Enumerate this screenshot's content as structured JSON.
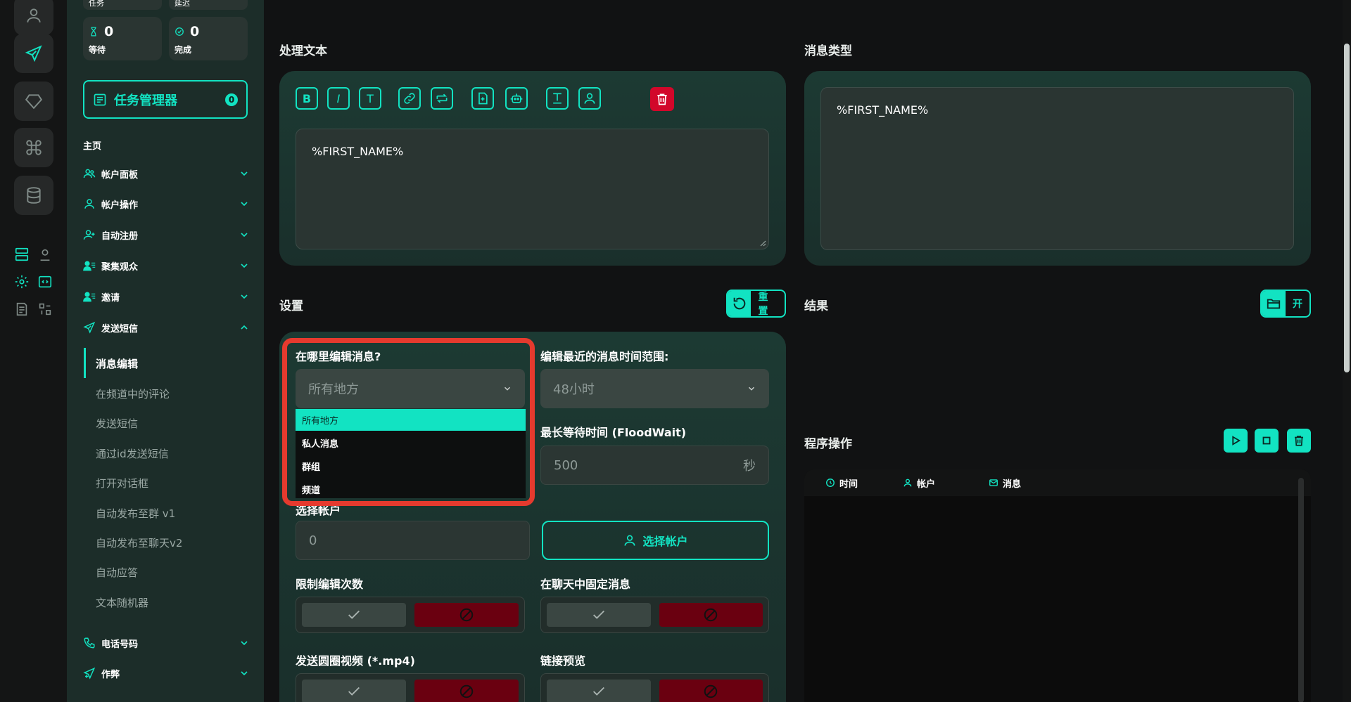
{
  "sidebar": {
    "stats_top": [
      "任务",
      "延迟"
    ],
    "stats": [
      {
        "value": "0",
        "label": "等待"
      },
      {
        "value": "0",
        "label": "完成"
      }
    ],
    "task_manager": {
      "label": "任务管理器",
      "count": "0"
    },
    "section_title": "主页",
    "nav": [
      {
        "label": "帐户面板",
        "icon": "users-icon"
      },
      {
        "label": "帐户操作",
        "icon": "user-icon"
      },
      {
        "label": "自动注册",
        "icon": "user-plus-icon"
      },
      {
        "label": "聚集观众",
        "icon": "user-list-icon"
      },
      {
        "label": "邀请",
        "icon": "user-list-icon"
      },
      {
        "label": "发送短信",
        "icon": "send-icon"
      }
    ],
    "sub_items": [
      "消息编辑",
      "在频道中的评论",
      "发送短信",
      "通过id发送短信",
      "打开对话框",
      "自动发布至群 v1",
      "自动发布至聊天v2",
      "自动应答",
      "文本随机器"
    ],
    "nav_bottom": [
      {
        "label": "电话号码",
        "icon": "phone-icon"
      },
      {
        "label": "作弊",
        "icon": "send-plus-icon"
      }
    ]
  },
  "editor": {
    "label": "处理文本",
    "toolbar": [
      "B",
      "I",
      "T"
    ],
    "text": "%FIRST_NAME%"
  },
  "message_type": {
    "label": "消息类型",
    "text": "%FIRST_NAME%"
  },
  "settings": {
    "label": "设置",
    "reset_label": "重置",
    "where_label": "在哪里编辑消息?",
    "where_value": "所有地方",
    "where_options": [
      "所有地方",
      "私人消息",
      "群组",
      "频道"
    ],
    "range_label": "编辑最近的消息时间范围:",
    "range_value": "48小时",
    "floodwait_label": "最长等待时间 (FloodWait)",
    "floodwait_value": "500",
    "floodwait_unit": "秒",
    "accounts_label": "选择帐户",
    "count_value": "0",
    "select_accounts": "选择帐户",
    "limit_label": "限制编辑次数",
    "pin_label": "在聊天中固定消息",
    "video_label": "发送圆圈视频 (*.mp4)",
    "preview_label": "链接预览"
  },
  "results": {
    "label": "结果",
    "open_label": "开"
  },
  "program": {
    "label": "程序操作",
    "columns": [
      "时间",
      "帐户",
      "消息"
    ]
  },
  "colors": {
    "accent": "#12e3c2",
    "danger": "#d2072a",
    "highlight": "#e53a2e"
  }
}
